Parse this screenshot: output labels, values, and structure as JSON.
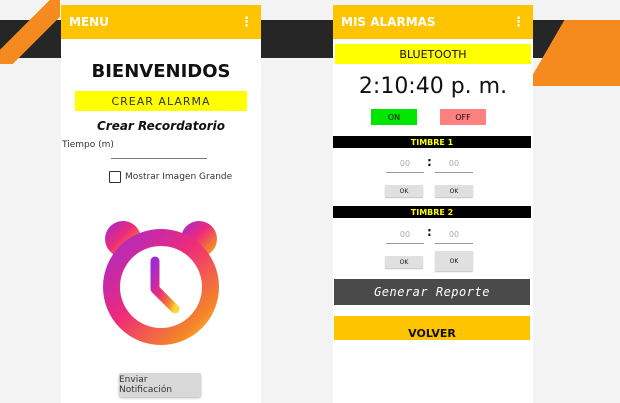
{
  "left_screen": {
    "appbar_title": "MENU",
    "more_icon": "more-vert-icon",
    "welcome": "BIENVENIDOS",
    "crear_alarma": "CREAR ALARMA",
    "crear_recordatorio": "Crear Recordatorio",
    "tiempo_label": "Tiempo (m)",
    "tiempo_value": "",
    "checkbox_label": "Mostrar Imagen Grande",
    "checkbox_checked": false,
    "clock_icon": "alarm-clock-icon",
    "notify_button": "Enviar Notificación"
  },
  "right_screen": {
    "appbar_title": "MIS ALARMAS",
    "more_icon": "more-vert-icon",
    "bluetooth_button": "BLUETOOTH",
    "time": "2:10:40 p. m.",
    "on_button": "ON",
    "off_button": "OFF",
    "timbre1": {
      "label": "TIMBRE 1",
      "hour_placeholder": "00",
      "minute_placeholder": "00",
      "separator": ":",
      "ok1": "OK",
      "ok2": "OK"
    },
    "timbre2": {
      "label": "TIMBRE 2",
      "hour_placeholder": "00",
      "minute_placeholder": "00",
      "separator": ":",
      "ok1": "OK",
      "ok2": "OK"
    },
    "report_button": "Generar Reporte",
    "back_button": "VOLVER"
  },
  "colors": {
    "appbar": "#ffc400",
    "yellow_button": "#ffff00",
    "on": "#00e600",
    "off": "#ff8080",
    "accent_orange": "#f58a1f",
    "dark": "#262626"
  }
}
